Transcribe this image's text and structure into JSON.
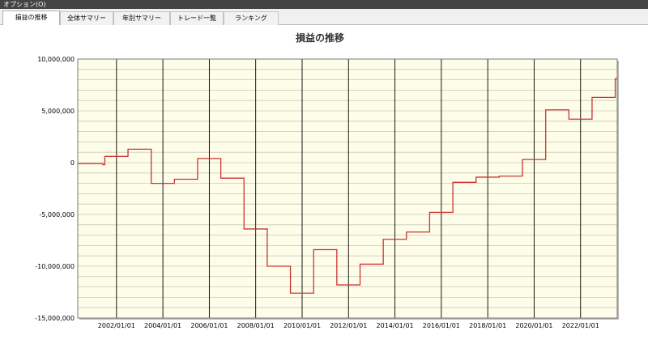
{
  "menubar": {
    "label": "オプション(O)"
  },
  "tabs": [
    {
      "label": "損益の推移",
      "active": true
    },
    {
      "label": "全体サマリー",
      "active": false
    },
    {
      "label": "年別サマリー",
      "active": false
    },
    {
      "label": "トレード一覧",
      "active": false
    },
    {
      "label": "ランキング",
      "active": false
    }
  ],
  "colors": {
    "plot_background": "#fefde9",
    "line": "#cc3333",
    "grid_minor": "#c8c8b4",
    "grid_major": "#000000"
  },
  "chart_data": {
    "type": "line",
    "title": "損益の推移",
    "xlabel": "",
    "ylabel": "",
    "step": true,
    "grid": true,
    "xlim": [
      "2000-05-01",
      "2023-08-01"
    ],
    "ylim": [
      -15000000,
      10000000
    ],
    "y_ticks": [
      {
        "value": 10000000,
        "label": "10,000,000"
      },
      {
        "value": 5000000,
        "label": "5,000,000"
      },
      {
        "value": 0,
        "label": "0"
      },
      {
        "value": -5000000,
        "label": "-5,000,000"
      },
      {
        "value": -10000000,
        "label": "-10,000,000"
      },
      {
        "value": -15000000,
        "label": "-15,000,000"
      }
    ],
    "x_ticks": [
      "2002/01/01",
      "2004/01/01",
      "2006/01/01",
      "2008/01/01",
      "2010/01/01",
      "2012/01/01",
      "2014/01/01",
      "2016/01/01",
      "2018/01/01",
      "2020/01/01",
      "2022/01/01"
    ],
    "series": [
      {
        "points": [
          {
            "x": "2000-05-01",
            "y": -100000
          },
          {
            "x": "2001-06-01",
            "y": -200000
          },
          {
            "x": "2001-07-01",
            "y": 600000
          },
          {
            "x": "2002-07-01",
            "y": 1300000
          },
          {
            "x": "2003-07-01",
            "y": -2000000
          },
          {
            "x": "2004-07-01",
            "y": -1600000
          },
          {
            "x": "2005-07-01",
            "y": 400000
          },
          {
            "x": "2006-07-01",
            "y": -1500000
          },
          {
            "x": "2007-07-01",
            "y": -6400000
          },
          {
            "x": "2008-07-01",
            "y": -10000000
          },
          {
            "x": "2009-07-01",
            "y": -12600000
          },
          {
            "x": "2010-07-01",
            "y": -8400000
          },
          {
            "x": "2011-07-01",
            "y": -11800000
          },
          {
            "x": "2012-07-01",
            "y": -9800000
          },
          {
            "x": "2013-07-01",
            "y": -7400000
          },
          {
            "x": "2014-07-01",
            "y": -6700000
          },
          {
            "x": "2015-07-01",
            "y": -4800000
          },
          {
            "x": "2016-07-01",
            "y": -1900000
          },
          {
            "x": "2017-07-01",
            "y": -1400000
          },
          {
            "x": "2018-07-01",
            "y": -1300000
          },
          {
            "x": "2019-07-01",
            "y": 300000
          },
          {
            "x": "2020-07-01",
            "y": 5100000
          },
          {
            "x": "2021-07-01",
            "y": 4200000
          },
          {
            "x": "2022-07-01",
            "y": 6300000
          },
          {
            "x": "2023-07-01",
            "y": 8100000
          }
        ]
      }
    ]
  }
}
